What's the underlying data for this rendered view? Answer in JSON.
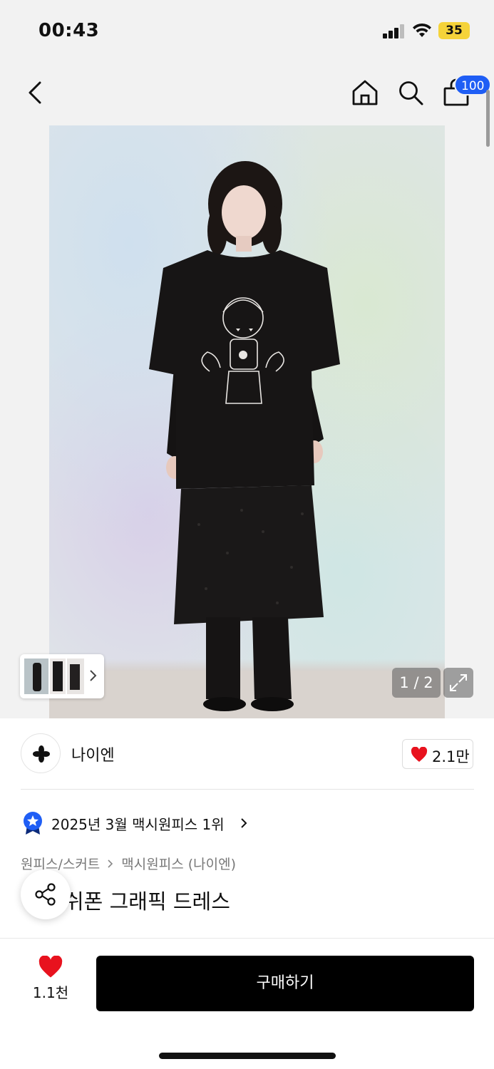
{
  "status_bar": {
    "time": "00:43",
    "battery": "35"
  },
  "nav": {
    "cart_count": "100"
  },
  "gallery": {
    "counter": "1 / 2"
  },
  "brand": {
    "name": "나이엔",
    "likes": "2.1만"
  },
  "ranking": {
    "text": "2025년 3월 맥시원피스 1위"
  },
  "breadcrumb": {
    "category": "원피스/스커트",
    "subcategory": "맥시원피스 (나이엔)"
  },
  "product": {
    "title": "쉬폰 그래픽 드레스"
  },
  "bottom_bar": {
    "wish_count": "1.1천",
    "buy_label": "구매하기"
  },
  "colors": {
    "accent_blue": "#1f5ef5",
    "heart_red": "#e8121e",
    "battery_yellow": "#f5d33a"
  },
  "icons": [
    "back-icon",
    "home-icon",
    "search-icon",
    "shopping-bag-icon",
    "expand-icon",
    "brand-logo-icon",
    "heart-icon",
    "rank-badge-icon",
    "chevron-right-icon",
    "share-icon"
  ]
}
